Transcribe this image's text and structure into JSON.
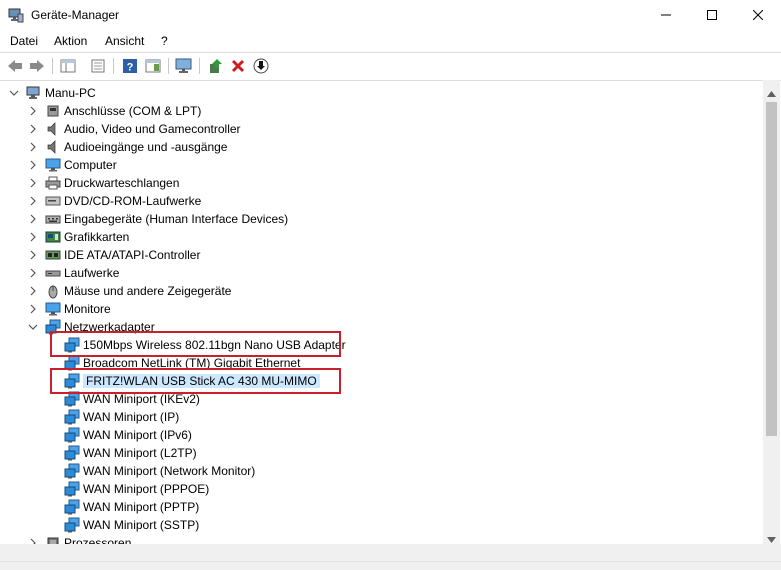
{
  "window": {
    "title": "Geräte-Manager"
  },
  "menu": [
    "Datei",
    "Aktion",
    "Ansicht",
    "?"
  ],
  "tree": {
    "root": "Manu-PC",
    "categories": [
      {
        "label": "Anschlüsse (COM & LPT)",
        "icon": "port-icon"
      },
      {
        "label": "Audio, Video und Gamecontroller",
        "icon": "speaker-icon"
      },
      {
        "label": "Audioeingänge und -ausgänge",
        "icon": "speaker-icon"
      },
      {
        "label": "Computer",
        "icon": "monitor-icon"
      },
      {
        "label": "Druckwarteschlangen",
        "icon": "printer-icon"
      },
      {
        "label": "DVD/CD-ROM-Laufwerke",
        "icon": "disc-icon"
      },
      {
        "label": "Eingabegeräte (Human Interface Devices)",
        "icon": "keyboard-icon"
      },
      {
        "label": "Grafikkarten",
        "icon": "display-adapter-icon"
      },
      {
        "label": "IDE ATA/ATAPI-Controller",
        "icon": "controller-icon"
      },
      {
        "label": "Laufwerke",
        "icon": "drive-icon"
      },
      {
        "label": "Mäuse und andere Zeigegeräte",
        "icon": "mouse-icon"
      },
      {
        "label": "Monitore",
        "icon": "monitor-icon"
      },
      {
        "label": "Netzwerkadapter",
        "icon": "network-icon"
      }
    ],
    "network_adapters": [
      "150Mbps Wireless 802.11bgn Nano USB Adapter",
      "Broadcom NetLink (TM) Gigabit Ethernet",
      "FRITZ!WLAN USB Stick AC 430 MU-MIMO",
      "WAN Miniport (IKEv2)",
      "WAN Miniport (IP)",
      "WAN Miniport (IPv6)",
      "WAN Miniport (L2TP)",
      "WAN Miniport (Network Monitor)",
      "WAN Miniport (PPPOE)",
      "WAN Miniport (PPTP)",
      "WAN Miniport (SSTP)"
    ],
    "after": "Prozessoren",
    "selected_adapter": "FRITZ!WLAN USB Stick AC 430 MU-MIMO"
  },
  "colors": {
    "selection": "#cce8ff",
    "highlight_box": "#c8202c",
    "net_icon": "#2a8bd8"
  }
}
